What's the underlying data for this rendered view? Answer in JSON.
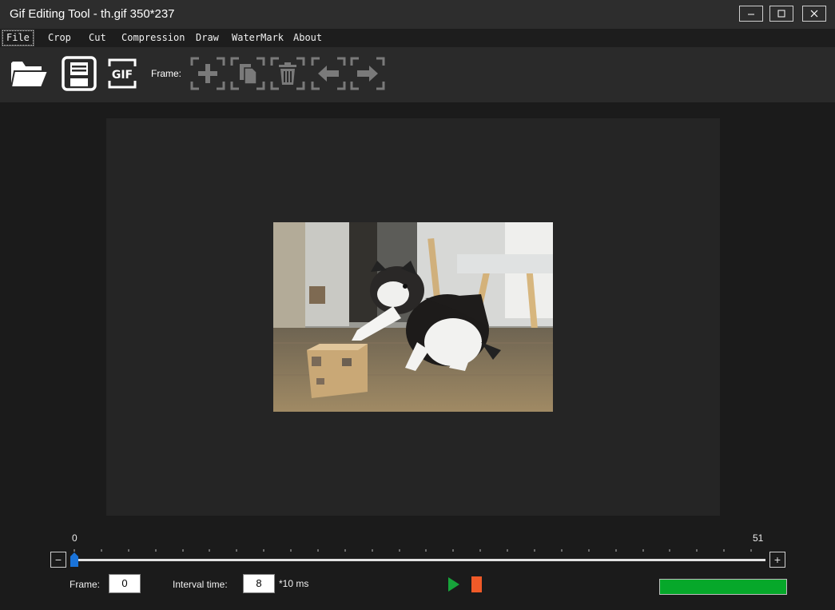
{
  "window": {
    "title": "Gif Editing Tool - th.gif 350*237",
    "minimize_label": "–",
    "maximize_label": "□",
    "close_label": "×"
  },
  "menu": {
    "items": [
      {
        "label": "File",
        "active": true
      },
      {
        "label": "Crop"
      },
      {
        "label": "Cut"
      },
      {
        "label": "Compression"
      },
      {
        "label": "Draw"
      },
      {
        "label": "WaterMark"
      },
      {
        "label": "About"
      }
    ]
  },
  "toolbar": {
    "open_icon": "open-folder-icon",
    "save_icon": "save-disk-icon",
    "gif_icon_label": "GIF",
    "frame_label": "Frame:",
    "frame_tools": [
      "add-frame-icon",
      "copy-frame-icon",
      "delete-frame-icon",
      "move-left-icon",
      "move-right-icon"
    ]
  },
  "timeline": {
    "min_label": "0",
    "max_label": "51",
    "minus_label": "−",
    "plus_label": "+",
    "position": 0,
    "accent_color": "#1a73d9"
  },
  "controls": {
    "frame_label": "Frame:",
    "frame_value": "0",
    "interval_label": "Interval time:",
    "interval_value": "8",
    "interval_unit": "*10 ms",
    "play_color": "#17a33a",
    "stop_color": "#f05a28",
    "progress_fraction": 1.0,
    "progress_color": "#06a82a"
  }
}
